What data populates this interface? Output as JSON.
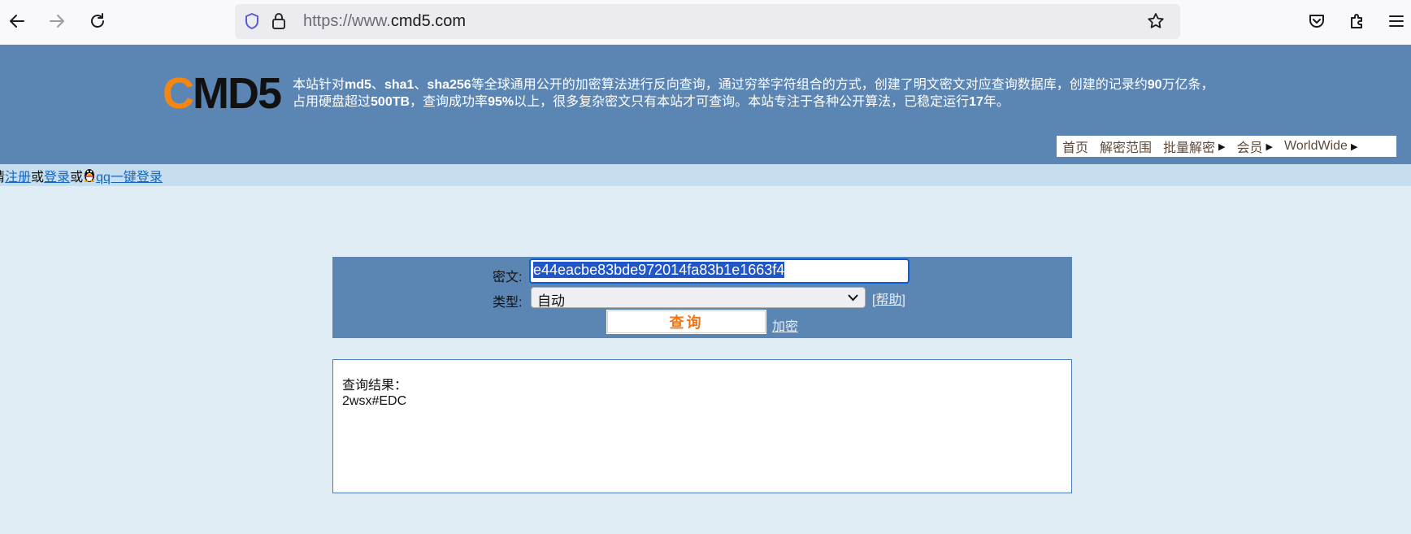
{
  "browser": {
    "url_scheme": "https://www.",
    "url_host": "cmd5.com"
  },
  "site": {
    "logo_c": "C",
    "logo_rest": "MD5",
    "intro_line1_parts": [
      "本站针对",
      "md5",
      "、",
      "sha1",
      "、",
      "sha256",
      "等全球通用公开的加密算法进行反向查询，通过穷举字符组合的方式，创建了明文密文对应查询数据库，创建的记录约",
      "90",
      "万亿条，"
    ],
    "intro_line2_parts": [
      "占用硬盘超过",
      "500TB",
      "，查询成功率",
      "95%",
      "以上，很多复杂密文只有本站才可查询。本站专注于各种公开算法，已稳定运行",
      "17",
      "年。"
    ],
    "nav": [
      {
        "label": "首页",
        "arrow": false
      },
      {
        "label": "解密范围",
        "arrow": false
      },
      {
        "label": "批量解密",
        "arrow": true
      },
      {
        "label": "会员",
        "arrow": true
      },
      {
        "label": "WorldWide",
        "arrow": true
      }
    ]
  },
  "login": {
    "prefix": "请",
    "register": "注册",
    "or1": "或",
    "login": "登录",
    "or2": "或",
    "qq_login": "qq一键登录"
  },
  "form": {
    "cipher_label": "密文:",
    "cipher_value": "e44eacbe83bde972014fa83b1e1663f4",
    "type_label": "类型:",
    "type_value": "自动",
    "help": "[帮助]",
    "query_button": "查询",
    "encrypt_link": "加密"
  },
  "result": {
    "label": "查询结果：",
    "value": "2wsx#EDC"
  },
  "colors": {
    "header_bg": "#5b86b4",
    "page_bg": "#e0edf5",
    "logo_orange": "#f58612",
    "button_text": "#f27413"
  }
}
